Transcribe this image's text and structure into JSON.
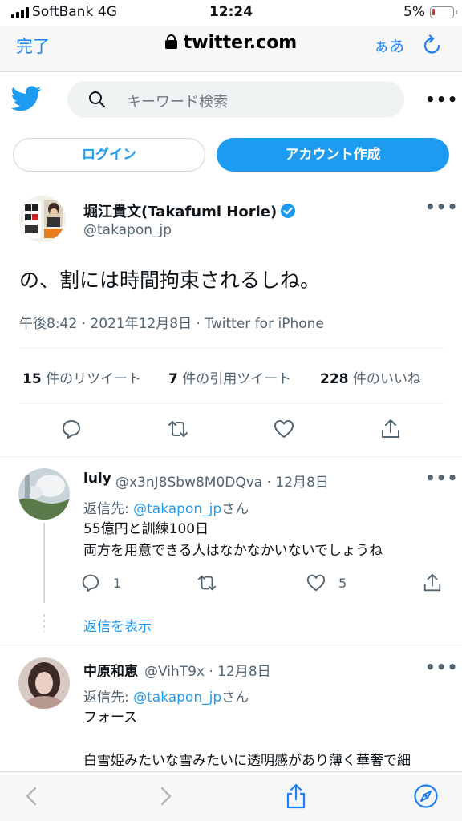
{
  "status_bar": {
    "carrier": "SoftBank",
    "network": "4G",
    "time": "12:24",
    "battery": "5%"
  },
  "browser": {
    "done_label": "完了",
    "url": "twitter.com",
    "text_size_label": "ぁあ",
    "reload_icon": "reload-icon",
    "back_icon": "chevron-left-icon",
    "forward_icon": "chevron-right-icon",
    "share_icon": "share-icon",
    "compass_icon": "compass-icon",
    "accent_color": "#1d7ff2"
  },
  "header": {
    "logo_icon": "twitter-bird-icon",
    "search_placeholder": "キーワード検索",
    "more_label": "•••",
    "login_label": "ログイン",
    "signup_label": "アカウント作成",
    "brand_color": "#1d9bf0"
  },
  "tweet": {
    "author_name": "堀江貴文(Takafumi Horie)",
    "handle": "@takapon_jp",
    "more_label": "•••",
    "text": "の、割には時間拘束されるしね。",
    "meta": "午後8:42 · 2021年12月8日 · Twitter for iPhone",
    "stats": {
      "retweets_count": "15",
      "retweets_label": " 件のリツイート",
      "quotes_count": "7",
      "quotes_label": " 件の引用ツイート",
      "likes_count": "228",
      "likes_label": " 件のいいね"
    },
    "actions": [
      "reply-icon",
      "retweet-icon",
      "like-icon",
      "share-icon"
    ]
  },
  "replies": [
    {
      "name": "luly",
      "handle": "@x3nJ8Sbw8M0DQva · 12月8日",
      "reply_to_prefix": "返信先: ",
      "reply_to": "@takapon_jp",
      "reply_to_suffix": "さん",
      "lines": [
        "55億円と訓練100日",
        "両方を用意できる人はなかなかいないでしょうね"
      ],
      "reply_count": "1",
      "like_count": "5",
      "more_label": "•••",
      "show_replies": "返信を表示"
    },
    {
      "name": "中原和恵",
      "handle": "@VihT9x · 12月8日",
      "reply_to_prefix": "返信先: ",
      "reply_to": "@takapon_jp",
      "reply_to_suffix": "さん",
      "lines": [
        "フォース",
        "",
        "白雪姫みたいな雪みたいに透明感があり薄く華奢で細"
      ],
      "more_label": "•••"
    }
  ]
}
